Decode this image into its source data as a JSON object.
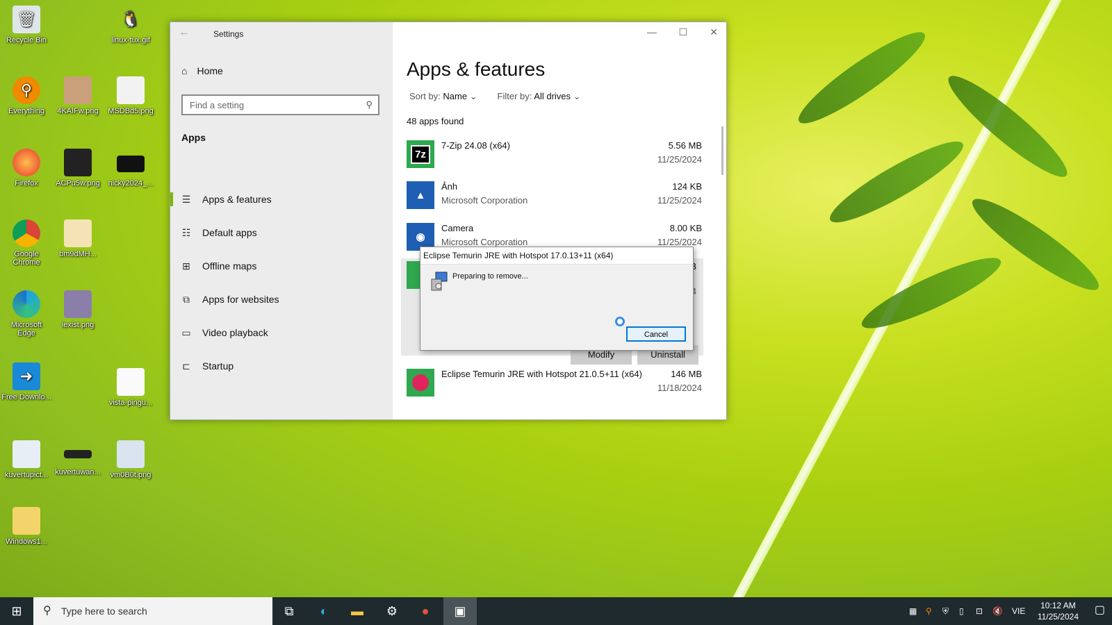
{
  "desktop": {
    "icons": [
      {
        "label": "Recycle Bin",
        "icon": "recycle-bin-icon"
      },
      {
        "label": "linux-tux.gif",
        "icon": "tux-icon"
      },
      {
        "label": "Everything",
        "icon": "search-icon"
      },
      {
        "label": "4KAIFw.png",
        "icon": "image-icon"
      },
      {
        "label": "MSDBd5.png",
        "icon": "image-icon"
      },
      {
        "label": "Firefox",
        "icon": "firefox-icon"
      },
      {
        "label": "ACPu5w.png",
        "icon": "image-icon"
      },
      {
        "label": "nicky2024_...",
        "icon": "image-icon"
      },
      {
        "label": "Google Chrome",
        "icon": "chrome-icon"
      },
      {
        "label": "bm9dMH...",
        "icon": "image-icon"
      },
      {
        "label": "Microsoft Edge",
        "icon": "edge-icon"
      },
      {
        "label": "iexist.png",
        "icon": "image-icon"
      },
      {
        "label": "Free Downlo...",
        "icon": "download-icon"
      },
      {
        "label": "vista-pingu...",
        "icon": "image-icon"
      },
      {
        "label": "kuvertupict...",
        "icon": "image-icon"
      },
      {
        "label": "kuvertuwan...",
        "icon": "image-icon"
      },
      {
        "label": "vm0B0t.png",
        "icon": "image-icon"
      },
      {
        "label": "Windows1...",
        "icon": "folder-icon"
      }
    ]
  },
  "settings": {
    "title": "Settings",
    "home": "Home",
    "search_placeholder": "Find a setting",
    "section": "Apps",
    "nav": [
      {
        "label": "Apps & features",
        "active": true
      },
      {
        "label": "Default apps"
      },
      {
        "label": "Offline maps"
      },
      {
        "label": "Apps for websites"
      },
      {
        "label": "Video playback"
      },
      {
        "label": "Startup"
      }
    ],
    "page_title": "Apps & features",
    "sort_label": "Sort by:",
    "sort_value": "Name",
    "filter_label": "Filter by:",
    "filter_value": "All drives",
    "count": "48 apps found",
    "apps": [
      {
        "name": "7-Zip 24.08 (x64)",
        "publisher": "",
        "size": "5.56 MB",
        "date": "11/25/2024",
        "logo": "7z",
        "color": "#000000"
      },
      {
        "name": "Ảnh",
        "publisher": "Microsoft Corporation",
        "size": "124 KB",
        "date": "11/25/2024",
        "logo": "",
        "color": "#1e5fb4"
      },
      {
        "name": "Camera",
        "publisher": "Microsoft Corporation",
        "size": "8.00 KB",
        "date": "11/25/2024",
        "logo": "",
        "color": "#1e5fb4"
      },
      {
        "name": "Eclipse Temurin JRE with Hotspot 21.0.5+11 (x64)",
        "publisher": "",
        "size": "146 MB",
        "date": "11/18/2024",
        "logo": "",
        "color": "#e0245e"
      }
    ],
    "selected_partial_size": "MB",
    "selected_partial_date": "24",
    "modify_label": "Modify",
    "uninstall_label": "Uninstall"
  },
  "dialog": {
    "title": "Eclipse Temurin JRE with Hotspot 17.0.13+11 (x64)",
    "message": "Preparing to remove...",
    "cancel": "Cancel"
  },
  "taskbar": {
    "search_placeholder": "Type here to search",
    "lang": "VIE",
    "time": "10:12 AM",
    "date": "11/25/2024"
  }
}
